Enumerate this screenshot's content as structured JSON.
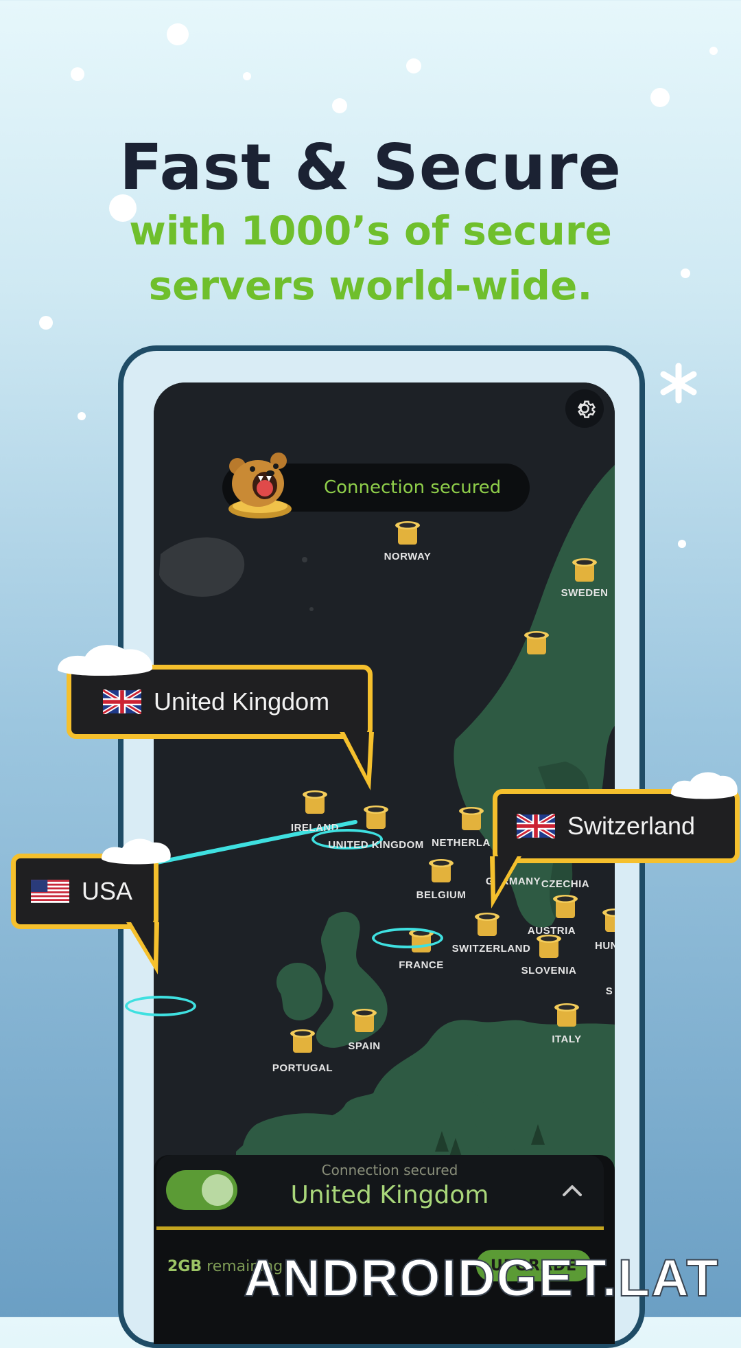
{
  "headline": {
    "title": "Fast & Secure",
    "subtitle_line1": "with 1000’s of secure",
    "subtitle_line2": "servers world-wide."
  },
  "colors": {
    "accent_green": "#6fbf2c",
    "callout_border": "#f5c02d",
    "connection_ring": "#3fe0e0",
    "map_land": "#2e5a43",
    "map_sea": "#1d2126"
  },
  "app": {
    "status_pill": "Connection secured",
    "settings_icon": "gear-icon",
    "mascot_icon": "bear-in-pot-icon"
  },
  "map": {
    "servers": [
      {
        "label": "NORWAY"
      },
      {
        "label": "SWEDEN"
      },
      {
        "label": ""
      },
      {
        "label": "IRELAND"
      },
      {
        "label": "UNITED KINGDOM"
      },
      {
        "label": "NETHERLA"
      },
      {
        "label": "BELGIUM"
      },
      {
        "label": "GERMANY"
      },
      {
        "label": "CZECHIA"
      },
      {
        "label": "AUSTRIA"
      },
      {
        "label": "HUN"
      },
      {
        "label": "FRANCE"
      },
      {
        "label": "SWITZERLAND"
      },
      {
        "label": "SLOVENIA"
      },
      {
        "label": "S"
      },
      {
        "label": "SPAIN"
      },
      {
        "label": "PORTUGAL"
      },
      {
        "label": "ITALY"
      }
    ]
  },
  "callouts": {
    "uk": {
      "label": "United Kingdom",
      "flag_icon": "uk-flag-icon"
    },
    "usa": {
      "label": "USA",
      "flag_icon": "us-flag-icon"
    },
    "switzerland": {
      "label": "Switzerland",
      "flag_icon": "uk-flag-icon"
    }
  },
  "bottom_panel": {
    "status": "Connection secured",
    "country": "United Kingdom",
    "toggle_on": true,
    "remaining_amount": "2GB",
    "remaining_text": " remaining",
    "upgrade_label": "UPGRADE",
    "expand_icon": "chevron-up-icon"
  },
  "watermark": "ANDROIDGET.LAT"
}
